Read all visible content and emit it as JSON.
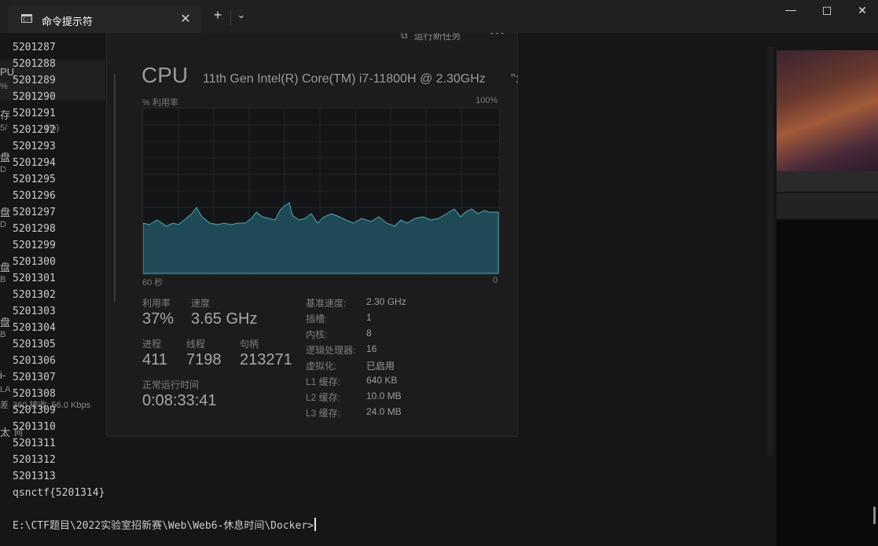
{
  "window": {
    "tab_title": "命令提示符",
    "tab_icon": "cmd-icon"
  },
  "terminal": {
    "lines": [
      "5201287",
      "5201288",
      "5201289",
      "5201290",
      "5201291",
      "5201292",
      "5201293",
      "5201294",
      "5201295",
      "5201296",
      "5201297",
      "5201298",
      "5201299",
      "5201300",
      "5201301",
      "5201302",
      "5201303",
      "5201304",
      "5201305",
      "5201306",
      "5201307",
      "5201308",
      "5201309",
      "5201310",
      "5201311",
      "5201312",
      "5201313",
      "qsnctf{5201314}"
    ],
    "prompt": "E:\\CTF题目\\2022实验室招新赛\\Web\\Web6-休息时间\\Docker>",
    "text_color": "#cccccc",
    "background": "#0c0c0c"
  },
  "task_manager": {
    "run_task_label": "运行新任务",
    "cpu_title": "CPU",
    "cpu_model": "11th Gen Intel(R) Core(TM) i7-11800H @ 2.30GHz",
    "graph_ylabel": "% 利用率",
    "graph_ymax": "100%",
    "graph_x_left": "60 秒",
    "graph_x_right": "0",
    "stats": {
      "util_label": "利用率",
      "util_value": "37%",
      "speed_label": "速度",
      "speed_value": "3.65 GHz",
      "proc_label": "进程",
      "proc_value": "411",
      "thread_label": "线程",
      "thread_value": "7198",
      "handle_label": "句柄",
      "handle_value": "213271",
      "uptime_label": "正常运行时间",
      "uptime_value": "0:08:33:41"
    },
    "specs": [
      {
        "k": "基准速度:",
        "v": "2.30 GHz"
      },
      {
        "k": "插槽:",
        "v": "1"
      },
      {
        "k": "内核:",
        "v": "8"
      },
      {
        "k": "逻辑处理器:",
        "v": "16"
      },
      {
        "k": "虚拟化:",
        "v": "已启用"
      },
      {
        "k": "L1 缓存:",
        "v": "640 KB"
      },
      {
        "k": "L2 缓存:",
        "v": "10.0 MB"
      },
      {
        "k": "L3 缓存:",
        "v": "24.0 MB"
      }
    ],
    "sidebar_fragments": [
      "PU",
      "%",
      "存",
      "5/",
      "盘",
      "D",
      "盘",
      "D",
      "盘",
      "B",
      "盘",
      "B",
      "i-",
      "LA",
      "差",
      "太",
      "网"
    ],
    "sidebar_partial": "(%)",
    "net_partial": "360 接收: 56.0 Kbps",
    "right_partial": "\":",
    "graph_color": "#1f4a55",
    "graph_line": "#4fa9b9"
  }
}
